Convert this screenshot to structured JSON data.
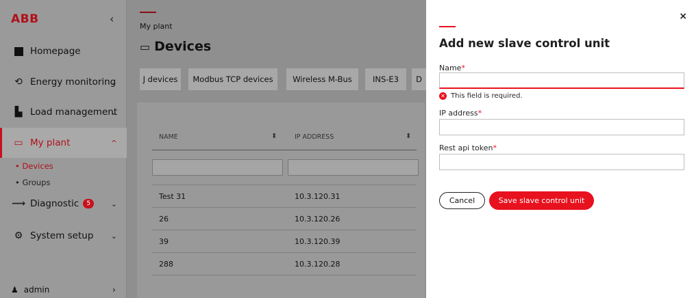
{
  "app": {
    "logo": "ABB",
    "collapse": "‹"
  },
  "sidebar": {
    "items": [
      {
        "label": "Homepage",
        "icon": "home-icon"
      },
      {
        "label": "Energy monitoring",
        "icon": "energy-icon",
        "chevron": "⌄"
      },
      {
        "label": "Load management",
        "icon": "load-icon",
        "chevron": "⌄"
      },
      {
        "label": "My plant",
        "icon": "plant-icon",
        "chevron": "^"
      },
      {
        "label": "Diagnostic",
        "icon": "diagnostic-icon",
        "chevron": "⌄",
        "badge": "5"
      },
      {
        "label": "System setup",
        "icon": "settings-icon",
        "chevron": "⌄"
      }
    ],
    "subitems": [
      "• Devices",
      "• Groups"
    ],
    "user": {
      "label": "admin",
      "chevron": "›"
    }
  },
  "main": {
    "breadcrumb": "My plant",
    "title": "Devices",
    "tabs": [
      "J devices",
      "Modbus TCP devices",
      "Wireless M-Bus",
      "INS-E3",
      "D"
    ],
    "columns": [
      "NAME",
      "IP ADDRESS"
    ],
    "rows": [
      {
        "name": "Test 31",
        "ip": "10.3.120.31"
      },
      {
        "name": "26",
        "ip": "10.3.120.26"
      },
      {
        "name": "39",
        "ip": "10.3.120.39"
      },
      {
        "name": "288",
        "ip": "10.3.120.28"
      }
    ]
  },
  "modal": {
    "close": "×",
    "title": "Add new slave control unit",
    "fields": [
      {
        "label": "Name",
        "required": "*",
        "value": ""
      },
      {
        "label": "IP address",
        "required": "*",
        "value": ""
      },
      {
        "label": "Rest api token",
        "required": "*",
        "value": ""
      }
    ],
    "error": "This field is required.",
    "cancel_label": "Cancel",
    "save_label": "Save slave control unit"
  },
  "colors": {
    "accent": "#e8111e",
    "overlay": "#8f8f8f"
  }
}
